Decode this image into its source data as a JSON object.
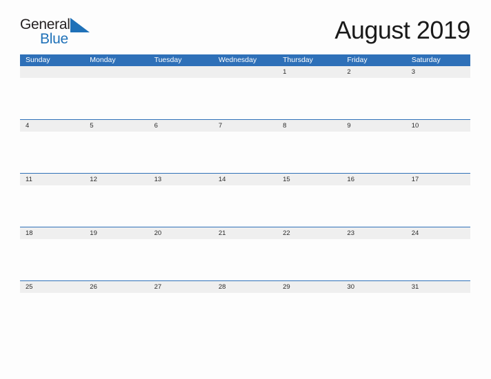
{
  "brand": {
    "name_part1": "General",
    "name_part2": "Blue",
    "triangle_icon": "triangle-icon",
    "color_dark": "#231F20",
    "color_blue": "#1F71B8"
  },
  "title": "August 2019",
  "calendar": {
    "month": "August",
    "year": "2019",
    "header_color": "#2E70B8",
    "band_color": "#EFEFEF",
    "weekday_headers": [
      "Sunday",
      "Monday",
      "Tuesday",
      "Wednesday",
      "Thursday",
      "Friday",
      "Saturday"
    ],
    "weeks": [
      {
        "rule": false,
        "days": [
          "",
          "",
          "",
          "",
          "1",
          "2",
          "3"
        ]
      },
      {
        "rule": true,
        "days": [
          "4",
          "5",
          "6",
          "7",
          "8",
          "9",
          "10"
        ]
      },
      {
        "rule": true,
        "days": [
          "11",
          "12",
          "13",
          "14",
          "15",
          "16",
          "17"
        ]
      },
      {
        "rule": true,
        "days": [
          "18",
          "19",
          "20",
          "21",
          "22",
          "23",
          "24"
        ]
      },
      {
        "rule": true,
        "days": [
          "25",
          "26",
          "27",
          "28",
          "29",
          "30",
          "31"
        ]
      }
    ]
  }
}
